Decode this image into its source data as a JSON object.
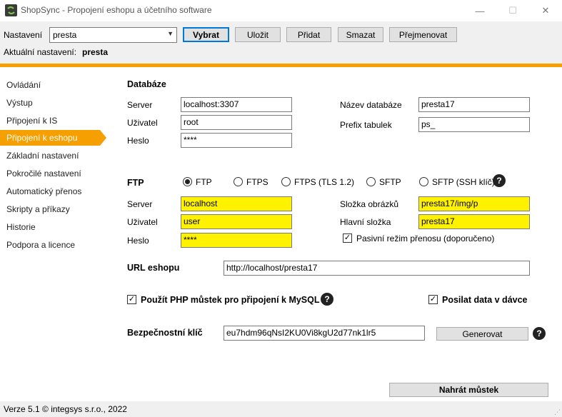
{
  "window": {
    "title": "ShopSync - Propojení eshopu a účetního software",
    "minimize": "—",
    "maximize": "☐",
    "close": "✕"
  },
  "toolbar": {
    "settings_label": "Nastavení",
    "profile_value": "presta",
    "select_label": "Vybrat",
    "save_label": "Uložit",
    "add_label": "Přidat",
    "delete_label": "Smazat",
    "rename_label": "Přejmenovat",
    "current_label": "Aktuální nastavení:",
    "current_value": "presta"
  },
  "sidebar": {
    "items": [
      {
        "label": "Ovládání"
      },
      {
        "label": "Výstup"
      },
      {
        "label": "Připojení k IS"
      },
      {
        "label": "Připojení k eshopu"
      },
      {
        "label": "Základní nastavení"
      },
      {
        "label": "Pokročilé nastavení"
      },
      {
        "label": "Automatický přenos"
      },
      {
        "label": "Skripty a příkazy"
      },
      {
        "label": "Historie"
      },
      {
        "label": "Podpora a licence"
      }
    ],
    "active_index": 3
  },
  "database": {
    "heading": "Databáze",
    "server_label": "Server",
    "server_value": "localhost:3307",
    "user_label": "Uživatel",
    "user_value": "root",
    "password_label": "Heslo",
    "password_value": "****",
    "dbname_label": "Název databáze",
    "dbname_value": "presta17",
    "prefix_label": "Prefix tabulek",
    "prefix_value": "ps_"
  },
  "ftp": {
    "heading": "FTP",
    "protocols": [
      "FTP",
      "FTPS",
      "FTPS (TLS 1.2)",
      "SFTP",
      "SFTP (SSH klíč)"
    ],
    "selected_protocol": "FTP",
    "server_label": "Server",
    "server_value": "localhost",
    "user_label": "Uživatel",
    "user_value": "user",
    "password_label": "Heslo",
    "password_value": "****",
    "images_label": "Složka obrázků",
    "images_value": "presta17/img/p",
    "main_label": "Hlavní složka",
    "main_value": "presta17",
    "passive_label": "Pasivní režim přenosu (doporučeno)",
    "passive_checked": true
  },
  "url": {
    "label": "URL eshopu",
    "value": "http://localhost/presta17"
  },
  "options": {
    "php_bridge_label": "Použít PHP můstek pro připojení k MySQL",
    "php_bridge_checked": true,
    "batch_label": "Posilat data v dávce",
    "batch_checked": true
  },
  "security": {
    "label": "Bezpečnostní klíč",
    "value": "eu7hdm96qNsI2KU0Vi8kgU2d77nk1lr5",
    "generate_label": "Generovat"
  },
  "upload_bridge_label": "Nahrát můstek",
  "status": {
    "text": "Verze 5.1  © integsys s.r.o., 2022"
  },
  "icons": {
    "check": "✓",
    "question": "?",
    "dropdown": "▼",
    "grip": "⋰"
  },
  "colors": {
    "accent": "#f5a000",
    "highlight": "#fff200",
    "focus": "#0078d7"
  }
}
